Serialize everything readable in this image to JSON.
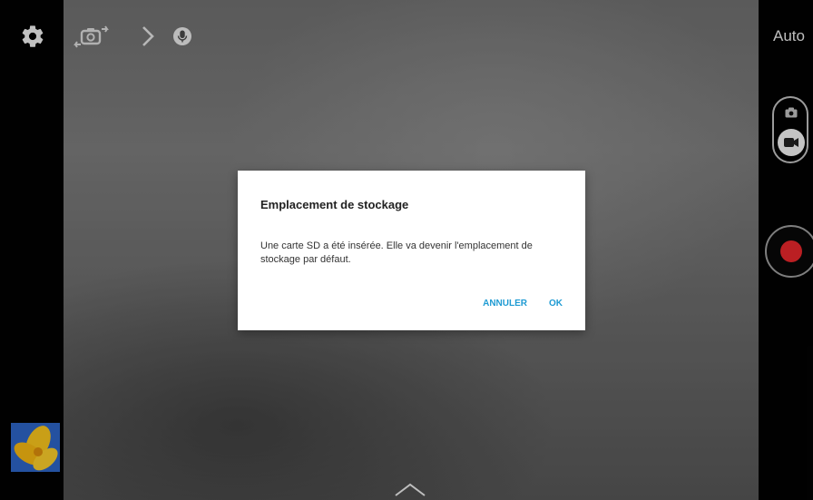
{
  "camera": {
    "flash_mode_label": "Auto",
    "icons": {
      "settings": "gear-icon",
      "switch_camera": "switch-camera-icon",
      "expand_modes": "chevron-right-icon",
      "audio": "microphone-icon",
      "photo_mode": "camera-icon",
      "video_mode": "video-camera-icon",
      "record": "record-icon",
      "gallery": "gallery-thumbnail",
      "expand_panel": "chevron-up-icon"
    },
    "colors": {
      "record": "#e4262b",
      "dialog_action": "#1f9bd3"
    }
  },
  "dialog": {
    "title": "Emplacement de stockage",
    "message": "Une carte SD a été insérée. Elle va devenir l'emplacement de stockage par défaut.",
    "cancel_label": "ANNULER",
    "ok_label": "OK"
  }
}
